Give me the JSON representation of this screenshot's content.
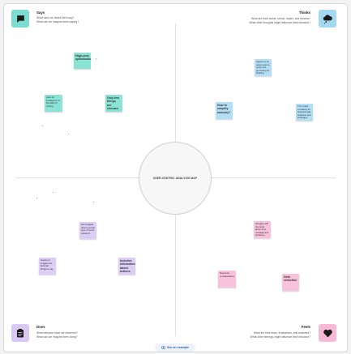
{
  "center_label": "USER-CENTRIC ANALYSIS MAP",
  "quadrants": {
    "says": {
      "title": "Says",
      "q1": "What have we heard them say?",
      "q2": "What can we imagine them saying?",
      "color": "#7ddccf",
      "icon": "speech-bubble-icon"
    },
    "thinks": {
      "title": "Thinks",
      "q1": "What are their wants, needs, hopes, and dreams?",
      "q2": "What other thoughts might influence their behavior?",
      "color": "#a5d8f3",
      "icon": "thought-cloud-icon"
    },
    "does": {
      "title": "Does",
      "q1": "What behavior have we observed?",
      "q2": "What can we imagine them doing?",
      "color": "#d8c8f4",
      "icon": "clipboard-icon"
    },
    "feels": {
      "title": "Feels",
      "q1": "What are their fears, frustrations, and anxieties?",
      "q2": "What other feelings might influence their behavior?",
      "color": "#f7b9d6",
      "icon": "heart-icon"
    }
  },
  "notes": {
    "says_1": "High-cost optimization",
    "says_2": "Asks for intelligence in the task it's solving",
    "says_3": "Only few things are relevant",
    "thinks_1": "Agrees to be using tools to solve and grounding its thinking",
    "thinks_2": "How to simplify industry?",
    "thinks_3": "The model considers for financial help solutions and strategies",
    "does_1": "Encouraged others people type of focus solutions",
    "does_2": "Inquire to imagine the factorial things to say",
    "does_3": "Includes information about actions",
    "feels_1": "Struggle with the limits about time management problems",
    "feels_2": "Requests considerations",
    "feels_3": "Gets reduction"
  },
  "example_button": "See an example",
  "colors": {
    "teal_note": "#8be3d6",
    "blue_note": "#b3dff6",
    "purple_note": "#dccdf6",
    "pink_note": "#f9c2dc",
    "axis": "#e2e2e2"
  }
}
